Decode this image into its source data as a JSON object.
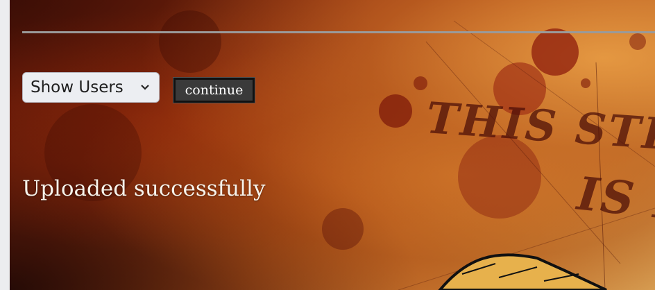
{
  "user_select": {
    "selected": "Show Users"
  },
  "actions": {
    "continue_label": "continue"
  },
  "status": {
    "message": "Uploaded successfully"
  },
  "background": {
    "poster_line_1": "THIS STRAW",
    "poster_line_2": "IS E"
  },
  "colors": {
    "button_bg": "#3a3a3a",
    "select_bg": "#eceef2",
    "rule": "#9a9a9a",
    "status_text": "#f6f2ea"
  }
}
